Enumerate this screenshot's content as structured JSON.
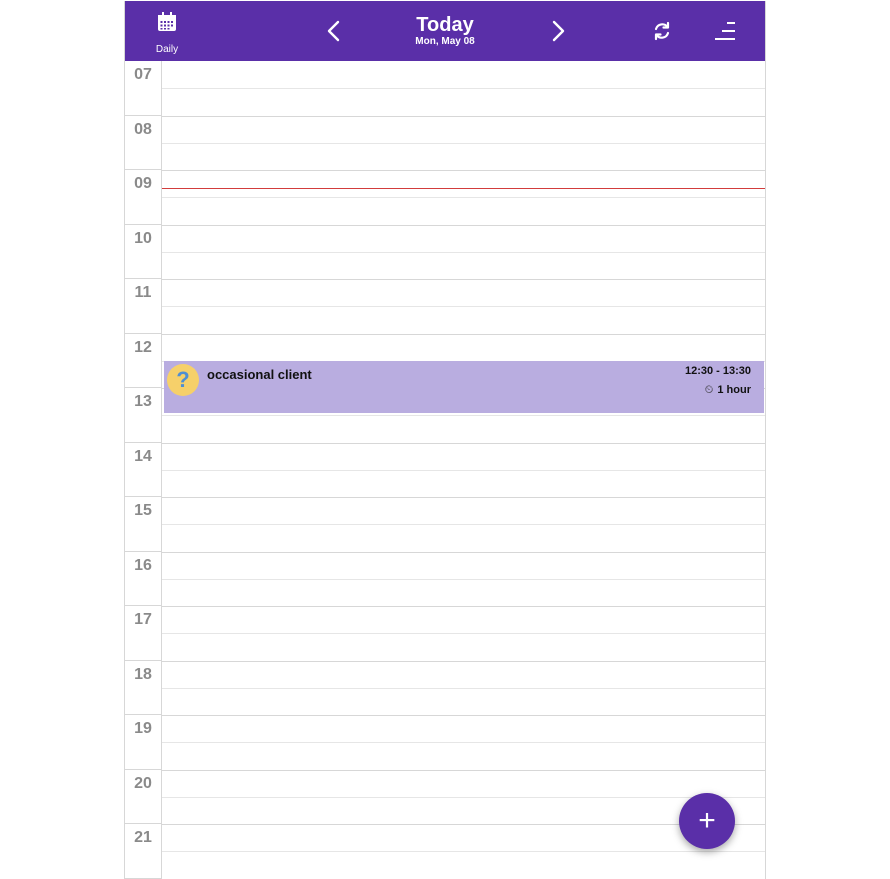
{
  "header": {
    "view_label": "Daily",
    "title": "Today",
    "date": "Mon, May 08"
  },
  "hours": [
    "07",
    "08",
    "09",
    "10",
    "11",
    "12",
    "13",
    "14",
    "15",
    "16",
    "17",
    "18",
    "19",
    "20",
    "21"
  ],
  "event": {
    "title": "occasional client",
    "time_range": "12:30 - 13:30",
    "duration": "1 hour",
    "avatar_icon": "question-mark-icon"
  },
  "fab": {
    "label": "+"
  },
  "colors": {
    "primary": "#5a2fa8",
    "event_bg": "#b9ade0",
    "now_line": "#d23c3c"
  }
}
